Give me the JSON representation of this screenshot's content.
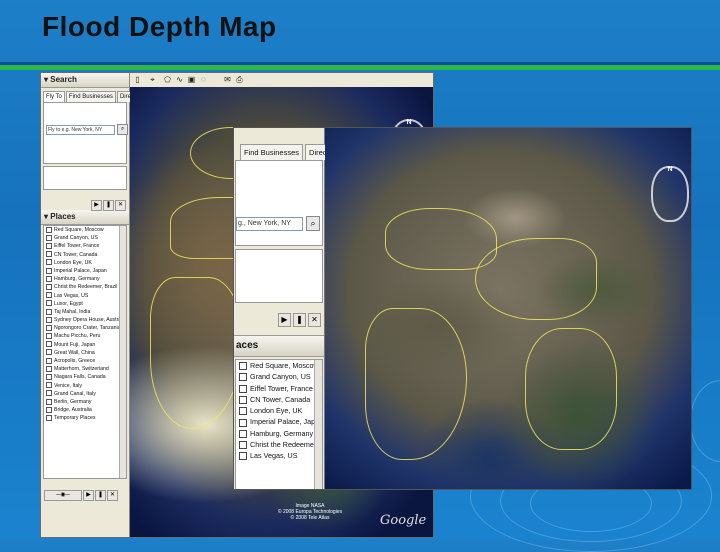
{
  "slide": {
    "title": "Flood Depth Map"
  },
  "back_window": {
    "search_panel_title": "Search",
    "tabs": [
      "Fly To",
      "Find Businesses",
      "Directions"
    ],
    "search_value": "Fly to e.g. New York, NY",
    "places_title": "Places",
    "places": [
      "Red Square, Moscow",
      "Grand Canyon, US",
      "Eiffel Tower, France",
      "CN Tower, Canada",
      "London Eye, UK",
      "Imperial Palace, Japan",
      "Hamburg, Germany",
      "Christ the Redeemer, Brazil",
      "Las Vegas, US",
      "Luxor, Egypt",
      "Taj Mahal, India",
      "Sydney Opera House, Australia",
      "Ngorongoro Crater, Tanzania",
      "Machu Picchu, Peru",
      "Mount Fuji, Japan",
      "Great Wall, China",
      "Acropolis, Greece",
      "Matterhorn, Switzerland",
      "Niagara Falls, Canada",
      "Venice, Italy",
      "Grand Canal, Italy",
      "Berlin, Germany",
      "Bridge, Australia",
      "Temporary Places"
    ],
    "watermark_lines": [
      "Image NASA",
      "© 2008 Europa Technologies",
      "© 2008 Tele Atlas"
    ],
    "logo_text": "Google"
  },
  "front_window": {
    "tabs": [
      "Find Businesses",
      "Directions"
    ],
    "search_value": "g., New York, NY",
    "places_title": "aces",
    "places": [
      "Red Square, Moscow",
      "Grand Canyon, US",
      "Eiffel Tower, France",
      "CN Tower, Canada",
      "London Eye, UK",
      "Imperial Palace, Japan",
      "Hamburg, Germany",
      "Christ the Redeemer, Brazil",
      "Las Vegas, US"
    ]
  }
}
